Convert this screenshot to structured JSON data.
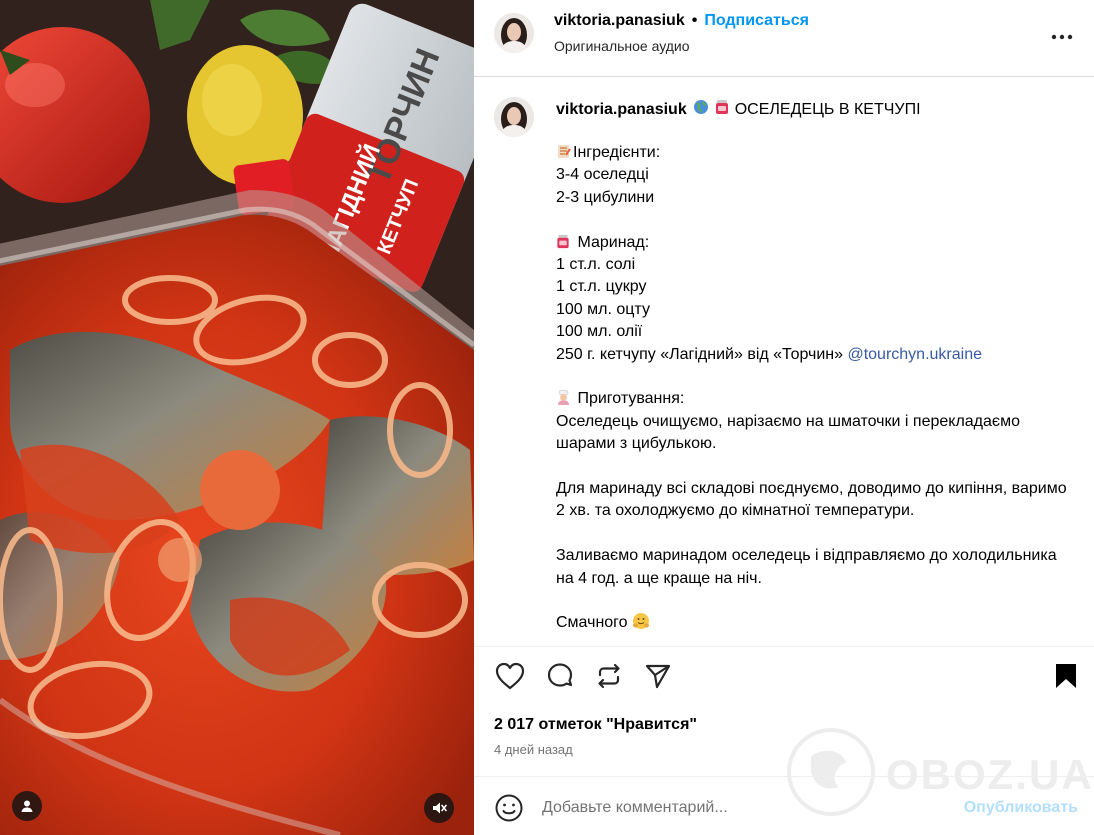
{
  "post": {
    "username": "viktoria.panasiuk",
    "follow_label": "Подписаться",
    "audio_label": "Оригинальное аудио",
    "title": "ОСЕЛЕДЕЦЬ В КЕТЧУПІ",
    "caption_lines": [
      {
        "type": "text",
        "emoji": "memo",
        "text": "Інгредієнти:"
      },
      {
        "type": "text",
        "text": "3-4 оселедці"
      },
      {
        "type": "text",
        "text": "2-3 цибулини"
      },
      {
        "type": "gap"
      },
      {
        "type": "text",
        "emoji": "jar",
        "text": " Маринад:"
      },
      {
        "type": "text",
        "text": "1 ст.л. солі"
      },
      {
        "type": "text",
        "text": "1 ст.л. цукру"
      },
      {
        "type": "text",
        "text": "100 мл. оцту"
      },
      {
        "type": "text",
        "text": "100 мл. олії"
      },
      {
        "type": "mention",
        "text": "250 г. кетчупу «Лагідний» від «Торчин» ",
        "mention": "@tourchyn.ukraine"
      },
      {
        "type": "gap"
      },
      {
        "type": "text",
        "emoji": "cook",
        "text": " Приготування:"
      },
      {
        "type": "text",
        "text": "Оселедець очищуємо, нарізаємо на шматочки і перекладаємо шарами з цибулькою."
      },
      {
        "type": "gap"
      },
      {
        "type": "text",
        "text": "Для маринаду всі складові поєднуємо, доводимо до кипіння, варимо 2 хв. та охолоджуємо до кімнатної температури."
      },
      {
        "type": "gap"
      },
      {
        "type": "text",
        "text": "Заливаємо маринадом оселедець і відправляємо до холодильника на 4 год. а ще краще на ніч."
      },
      {
        "type": "gap"
      },
      {
        "type": "text",
        "text": "Смачного",
        "emoji_after": "hug"
      }
    ],
    "likes_label": "2 017 отметок \"Нравится\"",
    "time_label": "4 дней назад"
  },
  "comment": {
    "placeholder": "Добавьте комментарий...",
    "post_label": "Опубликовать"
  },
  "watermark": {
    "text": "OBOZ.UA"
  },
  "photo": {
    "package_brand": "ТОРЧИН",
    "package_product": "ЛАГІДНИЙ",
    "package_type": "КЕТЧУП"
  },
  "icons": {
    "more": "more-horizontal-icon",
    "like": "heart-icon",
    "comment": "comment-icon",
    "share": "repost-icon",
    "send": "send-icon",
    "save": "bookmark-icon",
    "emoji": "smiley-icon",
    "tag": "user-tag-icon",
    "mute": "speaker-muted-icon"
  },
  "colors": {
    "accent": "#0095f6",
    "mention": "#385aa5",
    "post_disabled": "#b2dffc",
    "muted_text": "#737373"
  }
}
